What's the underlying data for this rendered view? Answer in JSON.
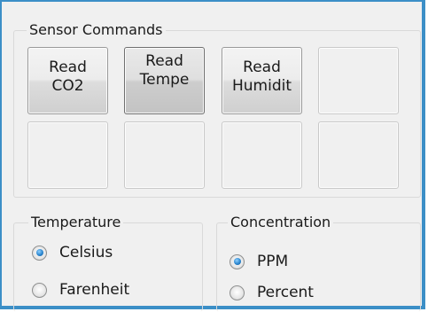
{
  "sensor_commands": {
    "title": "Sensor Commands",
    "buttons": [
      {
        "label": "Read\nCO2"
      },
      {
        "label": "Read\nTempe"
      },
      {
        "label": "Read\nHumidit"
      },
      {
        "label": ""
      },
      {
        "label": ""
      },
      {
        "label": ""
      },
      {
        "label": ""
      },
      {
        "label": ""
      }
    ]
  },
  "temperature": {
    "title": "Temperature",
    "options": [
      {
        "label": "Celsius",
        "selected": true
      },
      {
        "label": "Farenheit",
        "selected": false
      }
    ]
  },
  "concentration": {
    "title": "Concentration",
    "options": [
      {
        "label": "PPM",
        "selected": true
      },
      {
        "label": "Percent",
        "selected": false
      }
    ]
  },
  "colors": {
    "window_border": "#3c8fc7",
    "radio_selected": "#2b86cf"
  }
}
